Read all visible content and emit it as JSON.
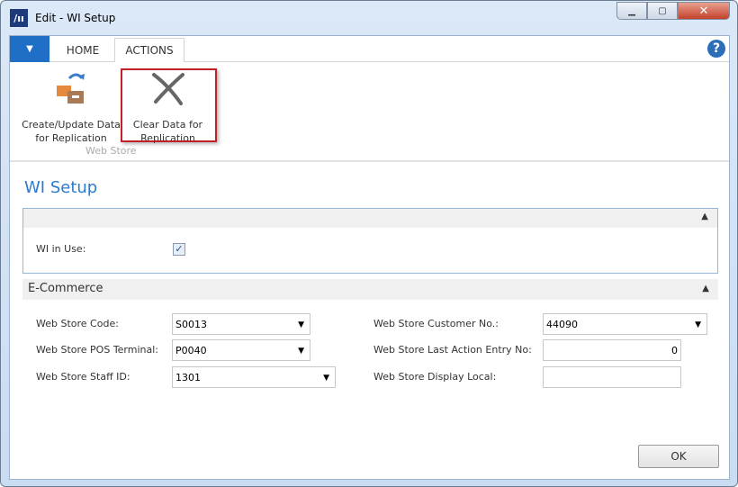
{
  "window": {
    "title": "Edit - WI Setup",
    "logo": "Dynamics NAV logo"
  },
  "tabs": [
    {
      "label": "HOME"
    },
    {
      "label": "ACTIONS"
    }
  ],
  "ribbon": {
    "create_update": "Create/Update Data\nfor Replication",
    "create_l1": "Create/Update Data",
    "create_l2": "for Replication",
    "clear_l1": "Clear Data for",
    "clear_l2": "Replication",
    "group": "Web Store"
  },
  "page_title": "WI Setup",
  "general": {
    "wi_in_use_label": "WI in Use:",
    "wi_in_use": true
  },
  "ecommerce": {
    "header": "E-Commerce",
    "web_store_code_label": "Web Store Code:",
    "web_store_code": "S0013",
    "pos_terminal_label": "Web Store POS Terminal:",
    "pos_terminal": "P0040",
    "staff_id_label": "Web Store Staff ID:",
    "staff_id": "1301",
    "customer_no_label": "Web Store Customer No.:",
    "customer_no": "44090",
    "last_action_label": "Web Store Last Action Entry No:",
    "last_action": "0",
    "display_local_label": "Web Store Display Local:",
    "display_local": ""
  },
  "ok_label": "OK",
  "colors": {
    "accent": "#2a7bd1",
    "highlight": "#c0202a"
  }
}
